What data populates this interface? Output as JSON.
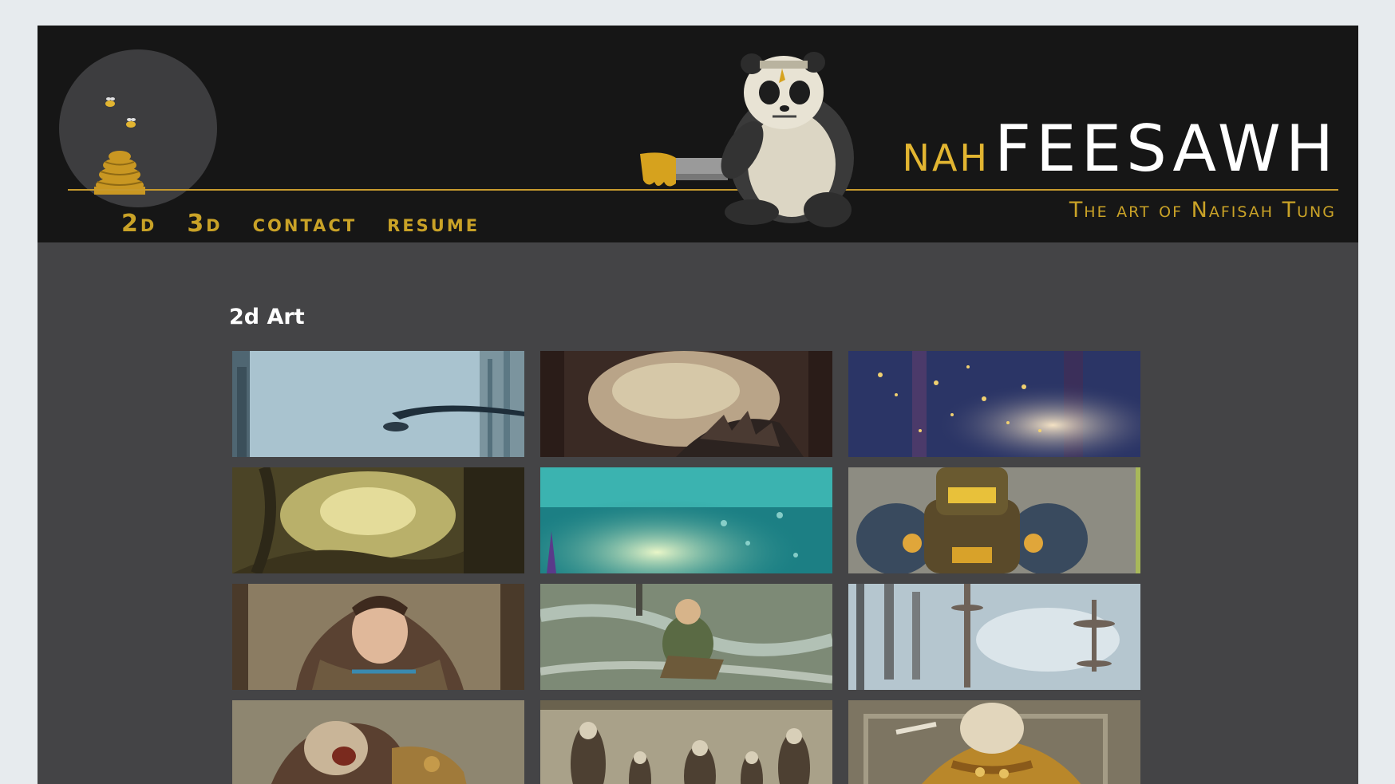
{
  "site": {
    "brand_prefix": "NAH",
    "brand_main": "FEESAWH",
    "tagline": "The art of Nafisah Tung"
  },
  "nav": {
    "items": [
      {
        "label": "2D"
      },
      {
        "label": "3D"
      },
      {
        "label": "CONTACT"
      },
      {
        "label": "RESUME"
      }
    ]
  },
  "gallery": {
    "title": "2d Art",
    "thumbnails": [
      {
        "icon": "city-streetlamp-painting"
      },
      {
        "icon": "cave-creature-painting"
      },
      {
        "icon": "glowing-forest-painting"
      },
      {
        "icon": "swamp-tree-painting"
      },
      {
        "icon": "underwater-light-painting"
      },
      {
        "icon": "armored-robot-painting"
      },
      {
        "icon": "hooded-child-portrait"
      },
      {
        "icon": "sky-rider-painting"
      },
      {
        "icon": "floating-towers-painting"
      },
      {
        "icon": "roaring-beast-warrior-painting"
      },
      {
        "icon": "animal-warriors-group-painting"
      },
      {
        "icon": "armored-animal-portrait"
      }
    ]
  }
}
